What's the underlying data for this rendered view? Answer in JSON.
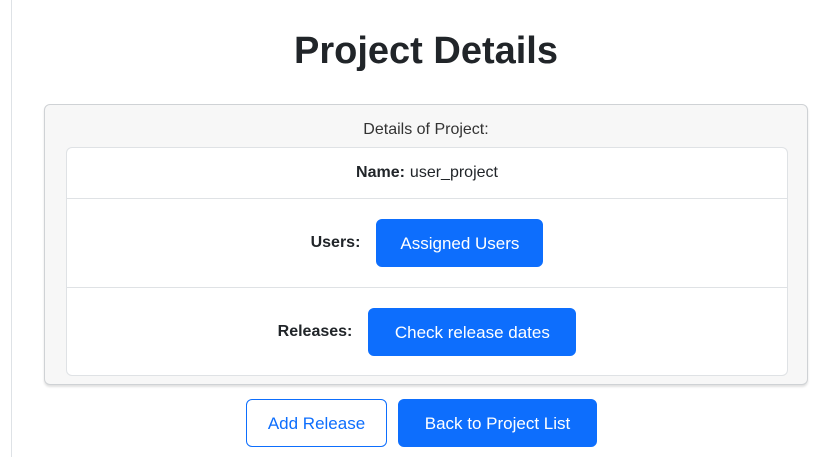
{
  "page": {
    "title": "Project Details"
  },
  "card": {
    "header": "Details of Project:",
    "name_label": "Name:",
    "name_value": "user_project",
    "users_label": "Users:",
    "users_button": "Assigned Users",
    "releases_label": "Releases:",
    "releases_button": "Check release dates"
  },
  "actions": {
    "add_release": "Add Release",
    "back": "Back to Project List"
  },
  "colors": {
    "primary": "#0d6efd",
    "text": "#212529",
    "card_bg": "#f7f7f7"
  }
}
